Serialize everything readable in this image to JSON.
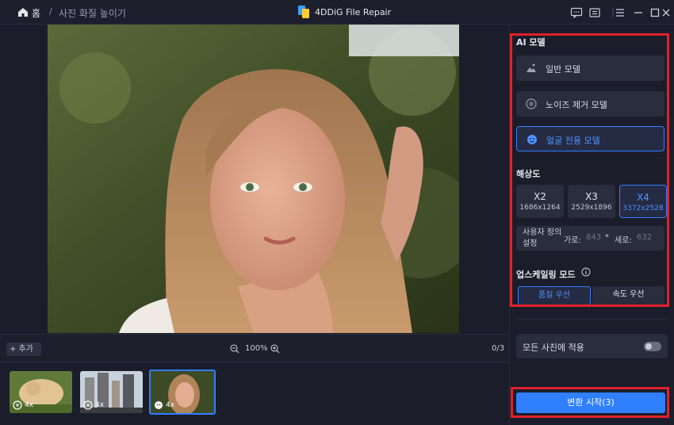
{
  "titlebar": {
    "home_label": "홈",
    "separator": "/",
    "page_label": "사진 화질 높이기",
    "app_title": "4DDiG File Repair",
    "icons": [
      "feedback-icon",
      "account-icon",
      "menu-icon",
      "minimize-icon",
      "maximize-icon",
      "close-icon"
    ]
  },
  "toolbar": {
    "add_label": "+ 추가",
    "zoom_level": "100%",
    "counter": "0/3"
  },
  "thumbnails": [
    {
      "badge": "4x",
      "subject": "puppy"
    },
    {
      "badge": "4x",
      "subject": "city"
    },
    {
      "badge": "4x",
      "subject": "portrait",
      "selected": true
    }
  ],
  "panel": {
    "ai_model_title": "AI 모델",
    "models": [
      {
        "label": "일반 모델",
        "icon": "landscape-icon",
        "active": false
      },
      {
        "label": "노이즈 제거 모델",
        "icon": "denoise-icon",
        "active": false
      },
      {
        "label": "얼굴 전용 모델",
        "icon": "face-icon",
        "active": true
      }
    ],
    "resolution_title": "해상도",
    "resolutions": [
      {
        "scale": "X2",
        "size": "1686x1264",
        "active": false
      },
      {
        "scale": "X3",
        "size": "2529x1896",
        "active": false
      },
      {
        "scale": "X4",
        "size": "3372x2528",
        "active": true
      }
    ],
    "custom": {
      "label": "사용자 정의 설정",
      "width_label": "가로:",
      "width_value": "843",
      "times": "*",
      "height_label": "세로:",
      "height_value": "632"
    },
    "upscale_title": "업스케일링 모드",
    "modes": {
      "quality": "품질 우선",
      "speed": "속도 우선"
    },
    "apply_all_label": "모든 사진에 적용",
    "start_label": "변환 시작(3)"
  },
  "colors": {
    "accent": "#2f7fff",
    "highlight": "#e0202c",
    "background": "#1b1d2a"
  }
}
